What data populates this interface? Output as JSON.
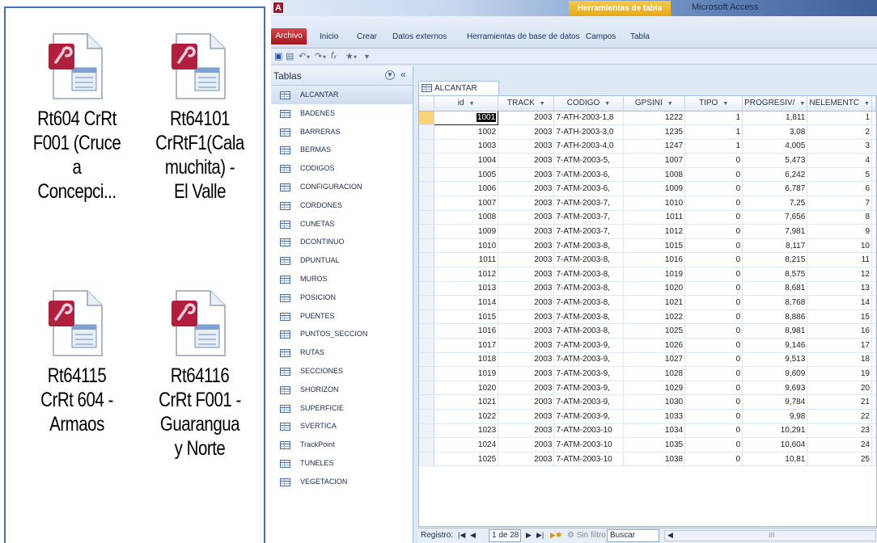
{
  "explorer": {
    "files": [
      {
        "name_lines": [
          "Rt604 CrRt",
          "F001 (Cruce",
          "a",
          "Concepci..."
        ]
      },
      {
        "name_lines": [
          "Rt64101",
          "CrRtF1(Cala",
          "muchita) -",
          "El Valle"
        ]
      },
      {
        "name_lines": [
          "Rt64115",
          "CrRt 604 -",
          "Armaos"
        ]
      },
      {
        "name_lines": [
          "Rt64116",
          "CrRt F001 -",
          "Guarangua",
          "y Norte"
        ]
      }
    ]
  },
  "app": {
    "logo": "A",
    "title": "Microsoft Access",
    "context_tab": "Herramientas de tabla",
    "tabs": {
      "archivo": "Archivo",
      "inicio": "Inicio",
      "crear": "Crear",
      "datos_externos": "Datos externos",
      "herramientas_bd": "Herramientas de base de datos",
      "campos": "Campos",
      "tabla": "Tabla"
    }
  },
  "nav": {
    "title": "Tablas",
    "items": [
      "ALCANTAR",
      "BADENES",
      "BARRERAS",
      "BERMAS",
      "CODIGOS",
      "CONFIGURACION",
      "CORDONES",
      "CUNETAS",
      "DCONTINUO",
      "DPUNTUAL",
      "MUROS",
      "POSICION",
      "PUENTES",
      "PUNTOS_SECCION",
      "RUTAS",
      "SECCIONES",
      "SHORIZON",
      "SUPERFICIE",
      "SVERTICA",
      "TrackPoint",
      "TUNELES",
      "VEGETACION"
    ]
  },
  "table": {
    "tab_label": "ALCANTAR",
    "columns": [
      "id",
      "TRACK",
      "CODIGO",
      "GPSINI",
      "TIPO",
      "PROGRESIV/",
      "NELEMENTC"
    ],
    "rows": [
      [
        "1001",
        "2003",
        "7-ATH-2003-1,8",
        "1222",
        "1",
        "1,811",
        "1"
      ],
      [
        "1002",
        "2003",
        "7-ATH-2003-3,0",
        "1235",
        "1",
        "3,08",
        "2"
      ],
      [
        "1003",
        "2003",
        "7-ATH-2003-4,0",
        "1247",
        "1",
        "4,005",
        "3"
      ],
      [
        "1004",
        "2003",
        "7-ATM-2003-5,",
        "1007",
        "0",
        "5,473",
        "4"
      ],
      [
        "1005",
        "2003",
        "7-ATM-2003-6,",
        "1008",
        "0",
        "6,242",
        "5"
      ],
      [
        "1006",
        "2003",
        "7-ATM-2003-6,",
        "1009",
        "0",
        "6,787",
        "6"
      ],
      [
        "1007",
        "2003",
        "7-ATM-2003-7,",
        "1010",
        "0",
        "7,25",
        "7"
      ],
      [
        "1008",
        "2003",
        "7-ATM-2003-7,",
        "1011",
        "0",
        "7,656",
        "8"
      ],
      [
        "1009",
        "2003",
        "7-ATM-2003-7,",
        "1012",
        "0",
        "7,981",
        "9"
      ],
      [
        "1010",
        "2003",
        "7-ATM-2003-8,",
        "1015",
        "0",
        "8,117",
        "10"
      ],
      [
        "1011",
        "2003",
        "7-ATM-2003-8,",
        "1016",
        "0",
        "8,215",
        "11"
      ],
      [
        "1012",
        "2003",
        "7-ATM-2003-8,",
        "1019",
        "0",
        "8,575",
        "12"
      ],
      [
        "1013",
        "2003",
        "7-ATM-2003-8,",
        "1020",
        "0",
        "8,681",
        "13"
      ],
      [
        "1014",
        "2003",
        "7-ATM-2003-8,",
        "1021",
        "0",
        "8,768",
        "14"
      ],
      [
        "1015",
        "2003",
        "7-ATM-2003-8,",
        "1022",
        "0",
        "8,886",
        "15"
      ],
      [
        "1016",
        "2003",
        "7-ATM-2003-8,",
        "1025",
        "0",
        "8,981",
        "16"
      ],
      [
        "1017",
        "2003",
        "7-ATM-2003-9,",
        "1026",
        "0",
        "9,146",
        "17"
      ],
      [
        "1018",
        "2003",
        "7-ATM-2003-9,",
        "1027",
        "0",
        "9,513",
        "18"
      ],
      [
        "1019",
        "2003",
        "7-ATM-2003-9,",
        "1028",
        "0",
        "9,609",
        "19"
      ],
      [
        "1020",
        "2003",
        "7-ATM-2003-9,",
        "1029",
        "0",
        "9,693",
        "20"
      ],
      [
        "1021",
        "2003",
        "7-ATM-2003-9,",
        "1030",
        "0",
        "9,784",
        "21"
      ],
      [
        "1022",
        "2003",
        "7-ATM-2003-9,",
        "1033",
        "0",
        "9,98",
        "22"
      ],
      [
        "1023",
        "2003",
        "7-ATM-2003-10",
        "1034",
        "0",
        "10,291",
        "23"
      ],
      [
        "1024",
        "2003",
        "7-ATM-2003-10",
        "1035",
        "0",
        "10,604",
        "24"
      ],
      [
        "1025",
        "2003",
        "7-ATM-2003-10",
        "1038",
        "0",
        "10,81",
        "25"
      ]
    ]
  },
  "status": {
    "registro_label": "Registro:",
    "record_of": "1 de 28",
    "filter": "Sin filtro",
    "search_placeholder": "Buscar"
  },
  "colors": {
    "access_red": "#a8102e",
    "context_gold": "#e6a80f",
    "explorer_border": "#3f72b6"
  }
}
